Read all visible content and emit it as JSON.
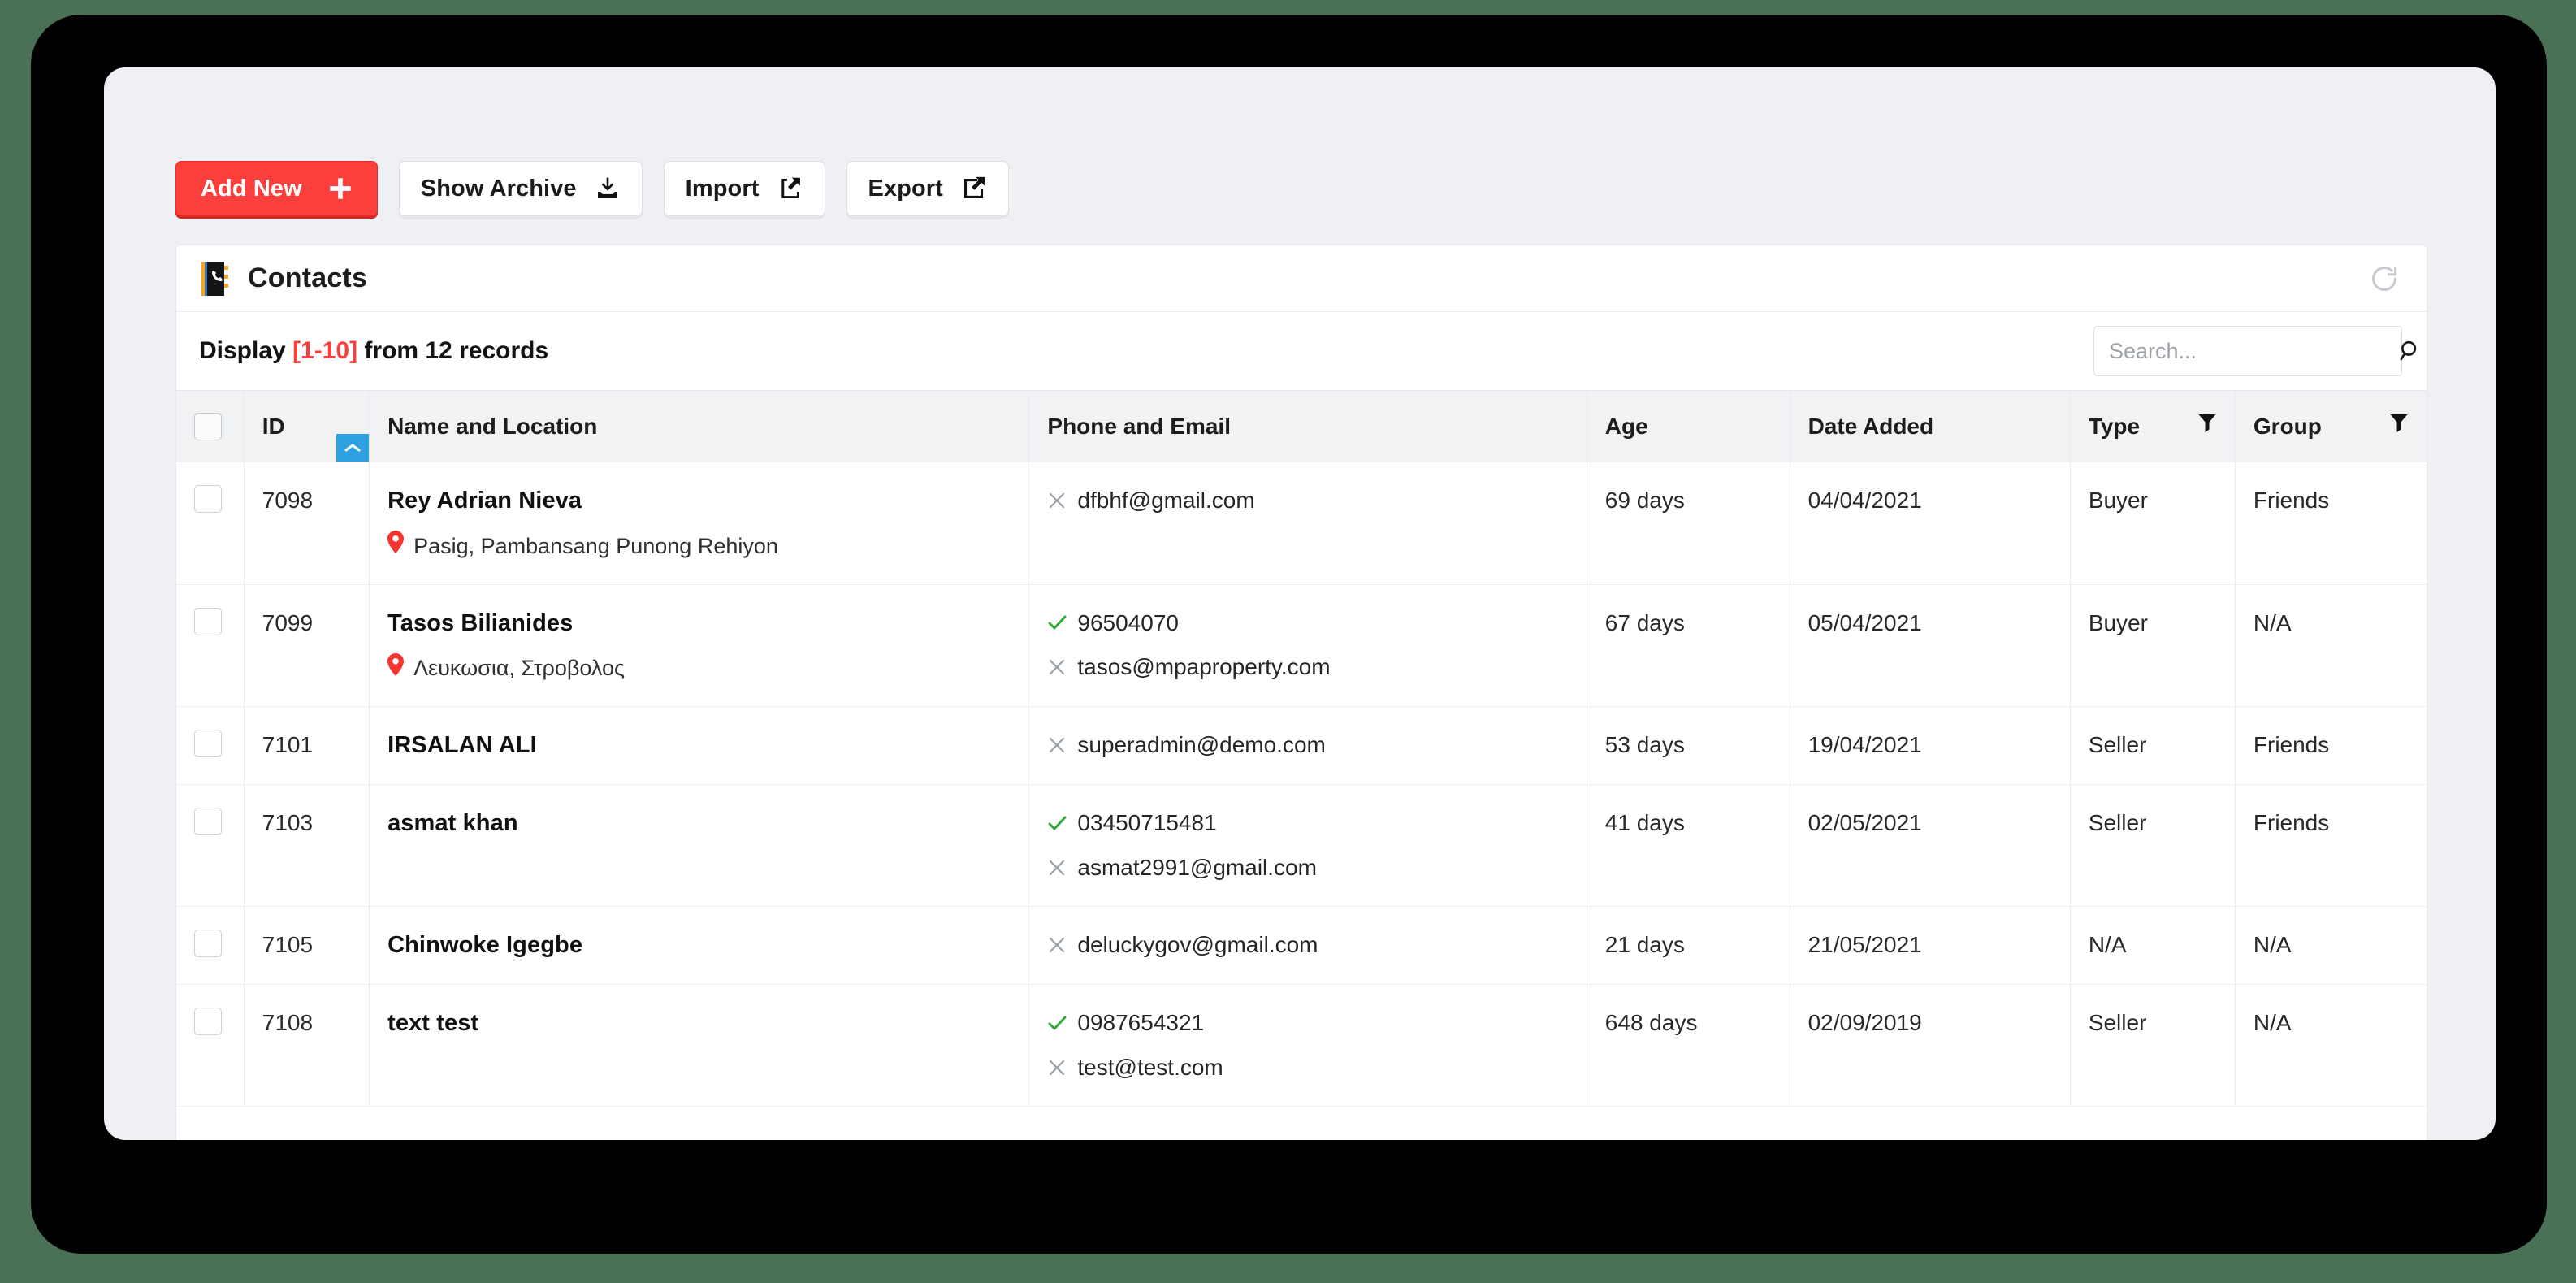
{
  "toolbar": {
    "buttons": [
      {
        "label": "Add New",
        "icon": "plus-icon",
        "style": "primary"
      },
      {
        "label": "Show Archive",
        "icon": "download-icon",
        "style": "ghost"
      },
      {
        "label": "Import",
        "icon": "import-icon",
        "style": "ghost"
      },
      {
        "label": "Export",
        "icon": "export-icon",
        "style": "ghost"
      }
    ]
  },
  "card": {
    "title": "Contacts",
    "panel_icon": "address-book-icon",
    "refresh_icon": "refresh-icon",
    "display_prefix": "Display ",
    "display_range": "[1-10]",
    "display_suffix": " from 12 records"
  },
  "search": {
    "placeholder": "Search...",
    "value": "",
    "icon": "search-icon"
  },
  "table": {
    "columns": [
      {
        "key": "check",
        "label": "",
        "sorted": false,
        "filter": false
      },
      {
        "key": "id",
        "label": "ID",
        "sorted": true,
        "filter": false,
        "sort_dir": "asc"
      },
      {
        "key": "name",
        "label": "Name and Location",
        "sorted": false,
        "filter": false
      },
      {
        "key": "phone",
        "label": "Phone and Email",
        "sorted": false,
        "filter": false
      },
      {
        "key": "age",
        "label": "Age",
        "sorted": false,
        "filter": false
      },
      {
        "key": "date",
        "label": "Date Added",
        "sorted": false,
        "filter": false
      },
      {
        "key": "type",
        "label": "Type",
        "sorted": false,
        "filter": true
      },
      {
        "key": "group",
        "label": "Group",
        "sorted": false,
        "filter": true
      }
    ],
    "rows": [
      {
        "id": "7098",
        "name": "Rey Adrian Nieva",
        "location": "Pasig, Pambansang Punong Rehiyon",
        "phone": "",
        "phone_status": "",
        "email": "dfbhf@gmail.com",
        "email_status": "invalid",
        "age": "69 days",
        "date": "04/04/2021",
        "type": "Buyer",
        "group": "Friends"
      },
      {
        "id": "7099",
        "name": "Tasos Bilianides",
        "location": "Λευκωσια, Στροβολος",
        "phone": "96504070",
        "phone_status": "valid",
        "email": "tasos@mpaproperty.com",
        "email_status": "invalid",
        "age": "67 days",
        "date": "05/04/2021",
        "type": "Buyer",
        "group": "N/A"
      },
      {
        "id": "7101",
        "name": "IRSALAN ALI",
        "location": "",
        "phone": "",
        "phone_status": "",
        "email": "superadmin@demo.com",
        "email_status": "invalid",
        "age": "53 days",
        "date": "19/04/2021",
        "type": "Seller",
        "group": "Friends"
      },
      {
        "id": "7103",
        "name": "asmat khan",
        "location": "",
        "phone": "03450715481",
        "phone_status": "valid",
        "email": "asmat2991@gmail.com",
        "email_status": "invalid",
        "age": "41 days",
        "date": "02/05/2021",
        "type": "Seller",
        "group": "Friends"
      },
      {
        "id": "7105",
        "name": "Chinwoke Igegbe",
        "location": "",
        "phone": "",
        "phone_status": "",
        "email": "deluckygov@gmail.com",
        "email_status": "invalid",
        "age": "21 days",
        "date": "21/05/2021",
        "type": "N/A",
        "group": "N/A"
      },
      {
        "id": "7108",
        "name": "text test",
        "location": "",
        "phone": "0987654321",
        "phone_status": "valid",
        "email": "test@test.com",
        "email_status": "invalid",
        "age": "648 days",
        "date": "02/09/2019",
        "type": "Seller",
        "group": "N/A"
      }
    ]
  },
  "colors": {
    "accent_red": "#fa3f3d",
    "sort_blue": "#2ea1e0",
    "valid_green": "#2faa36",
    "invalid_gray": "#9aa0a6",
    "pin_red": "#f4342f"
  }
}
